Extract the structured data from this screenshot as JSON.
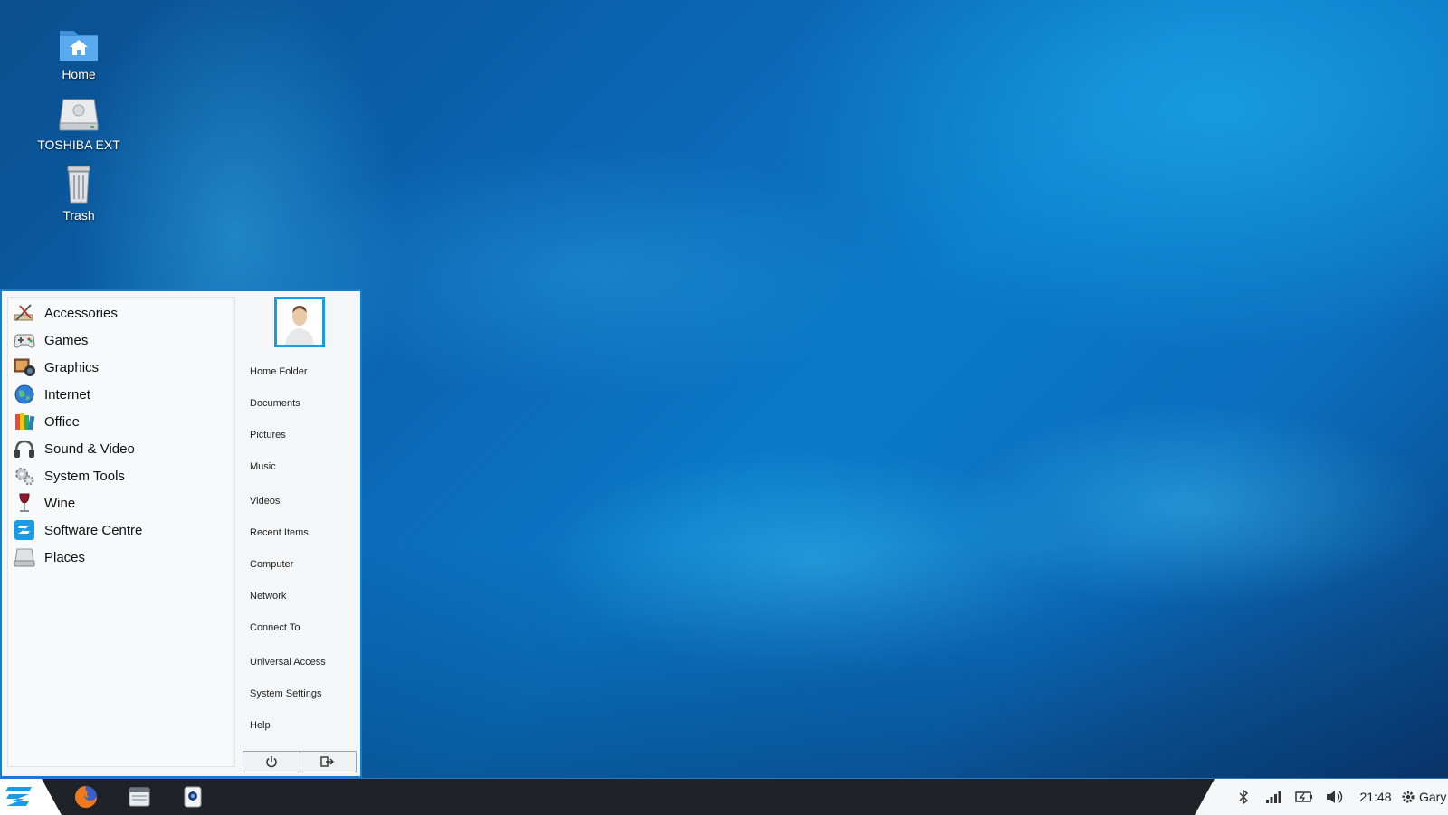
{
  "desktop": {
    "icons": [
      {
        "label": "Home",
        "icon": "home-folder-icon"
      },
      {
        "label": "TOSHIBA EXT",
        "icon": "external-drive-icon"
      },
      {
        "label": "Trash",
        "icon": "trash-icon"
      }
    ]
  },
  "start_menu": {
    "categories": [
      {
        "label": "Accessories",
        "icon": "accessories-icon"
      },
      {
        "label": "Games",
        "icon": "gamepad-icon"
      },
      {
        "label": "Graphics",
        "icon": "graphics-icon"
      },
      {
        "label": "Internet",
        "icon": "globe-icon"
      },
      {
        "label": "Office",
        "icon": "office-icon"
      },
      {
        "label": "Sound & Video",
        "icon": "headphones-icon"
      },
      {
        "label": "System Tools",
        "icon": "gears-icon"
      },
      {
        "label": "Wine",
        "icon": "wine-glass-icon"
      },
      {
        "label": "Software Centre",
        "icon": "software-centre-icon"
      },
      {
        "label": "Places",
        "icon": "drive-icon"
      }
    ],
    "places": [
      "Home Folder",
      "Documents",
      "Pictures",
      "Music",
      "Videos",
      "Recent Items",
      "Computer",
      "Network",
      "Connect To",
      "Universal Access",
      "System Settings",
      "Help"
    ],
    "buttons": [
      {
        "icon": "power-icon"
      },
      {
        "icon": "logout-icon"
      }
    ]
  },
  "taskbar": {
    "launchers": [
      "firefox-icon",
      "file-manager-icon",
      "screenshot-icon"
    ],
    "tray": {
      "clock": "21:48",
      "user": "Gary"
    }
  },
  "colors": {
    "accent": "#0c7fd6",
    "taskbar": "#1f2226",
    "tray": "#f6f7f8"
  }
}
